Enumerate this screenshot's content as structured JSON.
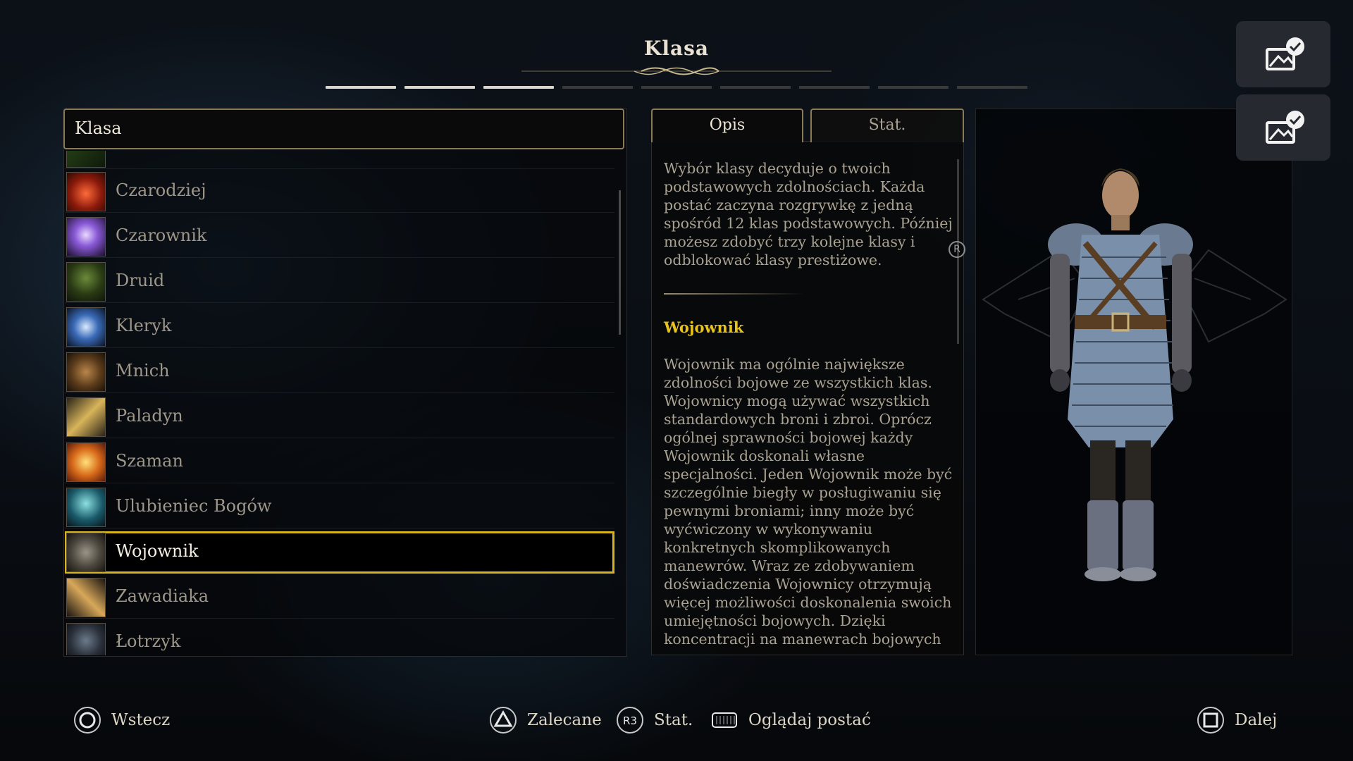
{
  "header": {
    "title": "Klasa",
    "steps_total": 9,
    "steps_done": 3
  },
  "list": {
    "header_label": "Klasa",
    "items": [
      {
        "label": "",
        "icon": "partial-class-icon"
      },
      {
        "label": "Czarodziej",
        "icon": "fire-spellbook-icon"
      },
      {
        "label": "Czarownik",
        "icon": "arcane-crystal-icon"
      },
      {
        "label": "Druid",
        "icon": "tree-icon"
      },
      {
        "label": "Kleryk",
        "icon": "holy-light-icon"
      },
      {
        "label": "Mnich",
        "icon": "fist-icon"
      },
      {
        "label": "Paladyn",
        "icon": "holy-sword-icon"
      },
      {
        "label": "Szaman",
        "icon": "spiral-spirit-icon"
      },
      {
        "label": "Ulubieniec Bogów",
        "icon": "divine-figure-icon"
      },
      {
        "label": "Wojownik",
        "icon": "crossed-weapons-shield-icon",
        "selected": true
      },
      {
        "label": "Zawadiaka",
        "icon": "rapier-icon"
      },
      {
        "label": "Łotrzyk",
        "icon": "hooded-rogue-icon"
      }
    ]
  },
  "tabs": {
    "description": "Opis",
    "stats": "Stat."
  },
  "description": {
    "intro": "Wybór klasy decyduje o twoich podstawowych zdolnościach. Każda postać zaczyna rozgrywkę z jedną spośród 12 klas podstawowych. Później możesz zdobyć trzy kolejne klasy i odblokować klasy prestiżowe.",
    "scroll_marker": "R",
    "class_name": "Wojownik",
    "class_text": "Wojownik ma ogólnie największe zdolności bojowe ze wszystkich klas. Wojownicy mogą używać wszystkich standardowych broni i zbroi. Oprócz ogólnej sprawności bojowej każdy Wojownik doskonali własne specjalności. Jeden Wojownik może być szczególnie biegły w posługiwaniu się pewnymi broniami; inny może być wyćwiczony w wykonywaniu konkretnych skomplikowanych manewrów. Wraz ze zdobywaniem doświadczenia Wojownicy otrzymują więcej możliwości doskonalenia swoich umiejętności bojowych. Dzięki koncentracji na manewrach bojowych Wojownicy..."
  },
  "footer": {
    "back": {
      "label": "Wstecz",
      "icon": "circle-button-icon"
    },
    "recommended": {
      "label": "Zalecane",
      "icon": "triangle-button-icon"
    },
    "stats": {
      "label": "Stat.",
      "icon": "r3-button-icon",
      "icon_text": "R3"
    },
    "view_character": {
      "label": "Oglądaj postać",
      "icon": "touchpad-icon"
    },
    "next": {
      "label": "Dalej",
      "icon": "square-button-icon"
    }
  },
  "colors": {
    "accent_gold": "#d8b41c",
    "frame_bronze": "#8a7a55",
    "heading_gold": "#e8c21a"
  }
}
